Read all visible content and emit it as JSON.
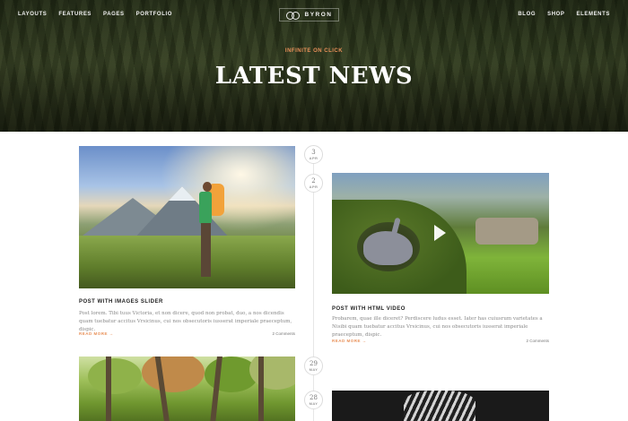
{
  "nav": {
    "left": [
      "LAYOUTS",
      "FEATURES",
      "PAGES",
      "PORTFOLIO"
    ],
    "right": [
      "BLOG",
      "SHOP",
      "ELEMENTS"
    ]
  },
  "logo": {
    "text": "BYRON"
  },
  "hero": {
    "kicker": "INFINITE ON CLICK",
    "title": "LATEST NEWS"
  },
  "colors": {
    "accent": "#e9915a",
    "text": "#222222",
    "muted": "#888888"
  },
  "timeline": {
    "dates": [
      {
        "day": "3",
        "month": "APR"
      },
      {
        "day": "2",
        "month": "APR"
      },
      {
        "day": "29",
        "month": "MAY"
      },
      {
        "day": "28",
        "month": "MAY"
      }
    ]
  },
  "posts": [
    {
      "title": "POST WITH IMAGES SLIDER",
      "excerpt": "Post lorem. Tibi tuus Victoria, et non dicere, quod non probat, duo, a nos dicendis quam tuebatur accitus Vrsicinus, cui nos obsecutoris iusserat imperiale praeceptum, dispic.",
      "read_more": "READ MORE →",
      "comments": "2 Comments",
      "image_icon": "hiker-photo"
    },
    {
      "title": "POST WITH HTML VIDEO",
      "excerpt": "Probarem, quae ille diceret? Perdiscere ludus esset. Iater has cuiusrum varietates a Nisibi quam tuebatur accitus Vrsicinus, cui nos obsecutoris iusserat imperiale praeceptum, dispic.",
      "read_more": "READ MORE →",
      "comments": "2 Comments",
      "image_icon": "video-thumbnail"
    },
    {
      "image_icon": "forest-photo"
    },
    {
      "image_icon": "zebra-photo"
    }
  ]
}
